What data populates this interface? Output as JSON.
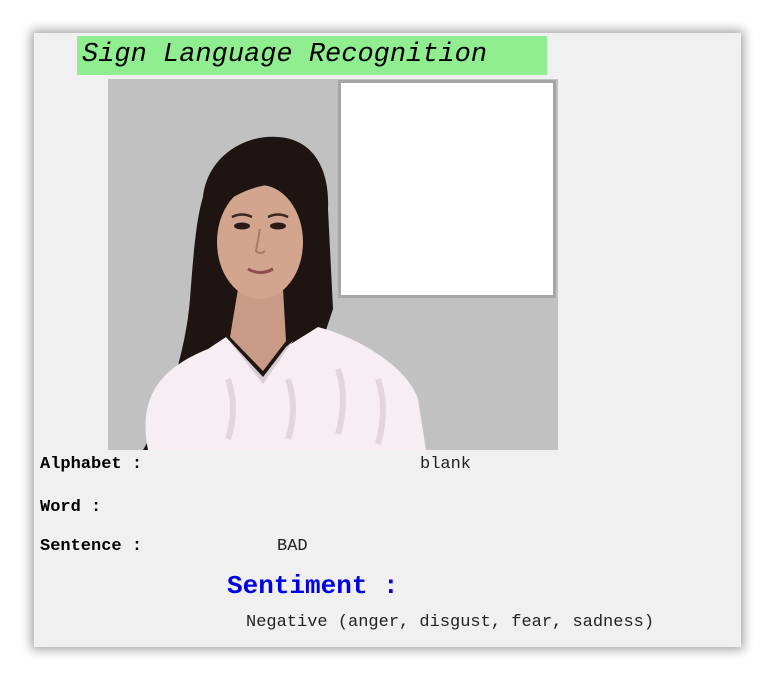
{
  "title": "Sign Language Recognition",
  "fields": {
    "alphabet_label": "Alphabet :",
    "alphabet_value": "blank",
    "word_label": "Word :",
    "word_value": "",
    "sentence_label": "Sentence :",
    "sentence_value": "BAD"
  },
  "sentiment": {
    "title": "Sentiment :",
    "value": "Negative (anger, disgust, fear, sadness)"
  },
  "colors": {
    "title_background": "#90ee90",
    "sentiment_title": "#0000e0",
    "window_background": "#f0f0f0"
  }
}
